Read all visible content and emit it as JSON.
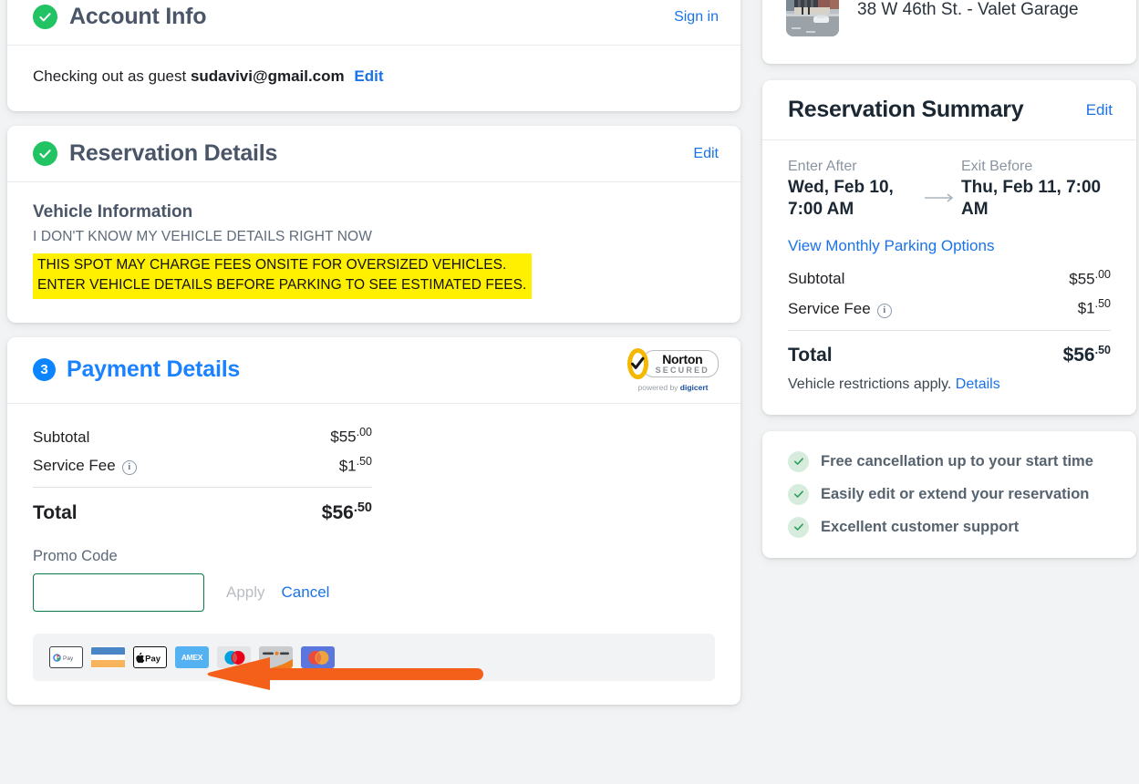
{
  "colors": {
    "page_bg": "#f1f3f4",
    "accent_blue": "#1a73e8",
    "green_check": "#22c362",
    "warning_yellow": "#fff000",
    "annotation_orange": "#f4601a",
    "promo_border_green": "#0a7a45"
  },
  "account_info": {
    "title": "Account Info",
    "status_icon": "green-check-icon",
    "sign_in_label": "Sign in",
    "guest_prefix": "Checking out as guest",
    "guest_email": "sudavivi@gmail.com",
    "edit_label": "Edit"
  },
  "reservation_details": {
    "title": "Reservation Details",
    "status_icon": "green-check-icon",
    "edit_label": "Edit",
    "vehicle_heading": "Vehicle Information",
    "vehicle_subtext": "I DON'T KNOW MY VEHICLE DETAILS RIGHT NOW",
    "warning_line_1": "THIS SPOT MAY CHARGE FEES ONSITE FOR OVERSIZED VEHICLES.",
    "warning_line_2": "ENTER VEHICLE DETAILS BEFORE PARKING TO SEE ESTIMATED FEES."
  },
  "payment_details": {
    "step_number": "3",
    "title": "Payment Details",
    "norton": {
      "word": "Norton",
      "secured": "SECURED",
      "powered_prefix": "powered by ",
      "powered_brand": "digicert"
    },
    "subtotal_label": "Subtotal",
    "subtotal_dollars": "$55",
    "subtotal_cents": ".00",
    "service_fee_label": "Service Fee",
    "service_fee_info_icon": "info-circle-icon",
    "service_fee_dollars": "$1",
    "service_fee_cents": ".50",
    "total_label": "Total",
    "total_dollars": "$56",
    "total_cents": ".50",
    "promo_label": "Promo Code",
    "promo_value": "",
    "promo_placeholder": "",
    "apply_label": "Apply",
    "cancel_label": "Cancel",
    "payment_methods": [
      {
        "name": "google-pay-icon",
        "label": "G Pay"
      },
      {
        "name": "visa-card-icon",
        "label": ""
      },
      {
        "name": "apple-pay-icon",
        "label": "Pay"
      },
      {
        "name": "amex-card-icon",
        "label": "AMEX"
      },
      {
        "name": "mastercard-white-icon",
        "label": ""
      },
      {
        "name": "discover-card-icon",
        "label": ""
      },
      {
        "name": "mastercard-blue-icon",
        "label": ""
      }
    ]
  },
  "location_card": {
    "thumbnail_icon": "garage-street-photo",
    "name": "38 W 46th St. - Valet Garage"
  },
  "reservation_summary": {
    "title": "Reservation Summary",
    "edit_label": "Edit",
    "enter_after_label": "Enter After",
    "enter_after_value": "Wed, Feb 10, 7:00 AM",
    "arrow_icon": "arrow-right-icon",
    "exit_before_label": "Exit Before",
    "exit_before_value": "Thu, Feb 11, 7:00 AM",
    "monthly_link": "View Monthly Parking Options",
    "subtotal_label": "Subtotal",
    "subtotal_dollars": "$55",
    "subtotal_cents": ".00",
    "service_fee_label": "Service Fee",
    "service_fee_info_icon": "info-circle-icon",
    "service_fee_dollars": "$1",
    "service_fee_cents": ".50",
    "total_label": "Total",
    "total_dollars": "$56",
    "total_cents": ".50",
    "restrictions_text": "Vehicle restrictions apply.",
    "restrictions_link": "Details"
  },
  "benefits": {
    "items": [
      {
        "icon": "check-circle-icon",
        "label": "Free cancellation up to your start time"
      },
      {
        "icon": "check-circle-icon",
        "label": "Easily edit or extend your reservation"
      },
      {
        "icon": "check-circle-icon",
        "label": "Excellent customer support"
      }
    ]
  },
  "annotation": {
    "icon": "left-arrow-annotation",
    "points_at": "promo-code-input"
  }
}
